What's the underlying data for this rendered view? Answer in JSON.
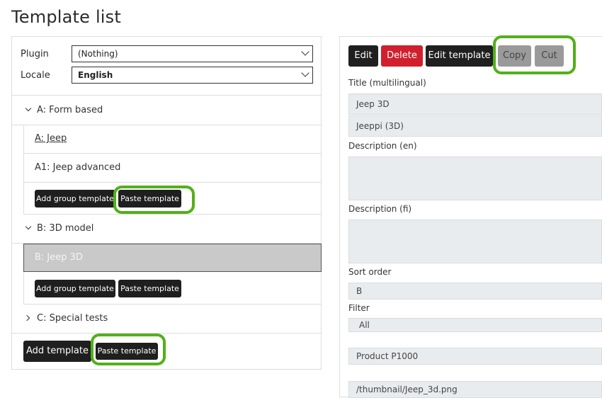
{
  "page": {
    "title": "Template list"
  },
  "filters": {
    "plugin_label": "Plugin",
    "plugin_value": "(Nothing)",
    "locale_label": "Locale",
    "locale_value": "English"
  },
  "groups": [
    {
      "label": "A: Form based",
      "items": [
        "A: Jeep",
        "A1: Jeep advanced"
      ],
      "add_group_label": "Add group template",
      "paste_label": "Paste template"
    },
    {
      "label": "B: 3D model",
      "items": [
        "B: Jeep 3D"
      ],
      "add_group_label": "Add group template",
      "paste_label": "Paste template"
    },
    {
      "label": "C: Special tests"
    }
  ],
  "footer": {
    "add_template_label": "Add template",
    "paste_label": "Paste template"
  },
  "toolbar": {
    "edit_label": "Edit",
    "delete_label": "Delete",
    "edit_template_label": "Edit template",
    "copy_label": "Copy",
    "cut_label": "Cut"
  },
  "details": {
    "title_label": "Title (multilingual)",
    "title_en": "Jeep 3D",
    "title_fi": "Jeeppi (3D)",
    "desc_en_label": "Description (en)",
    "desc_en": "",
    "desc_fi_label": "Description (fi)",
    "desc_fi": "",
    "sort_label": "Sort order",
    "sort_value": "B",
    "filter_label": "Filter",
    "filter_value": "All",
    "product_value": "Product P1000",
    "thumbnail_value": "/thumbnail/Jeep_3d.png"
  },
  "colors": {
    "highlight": "#52b01a",
    "danger": "#d0202e",
    "dark_button": "#1f1f1f",
    "selected_row": "#c9c9c9"
  }
}
